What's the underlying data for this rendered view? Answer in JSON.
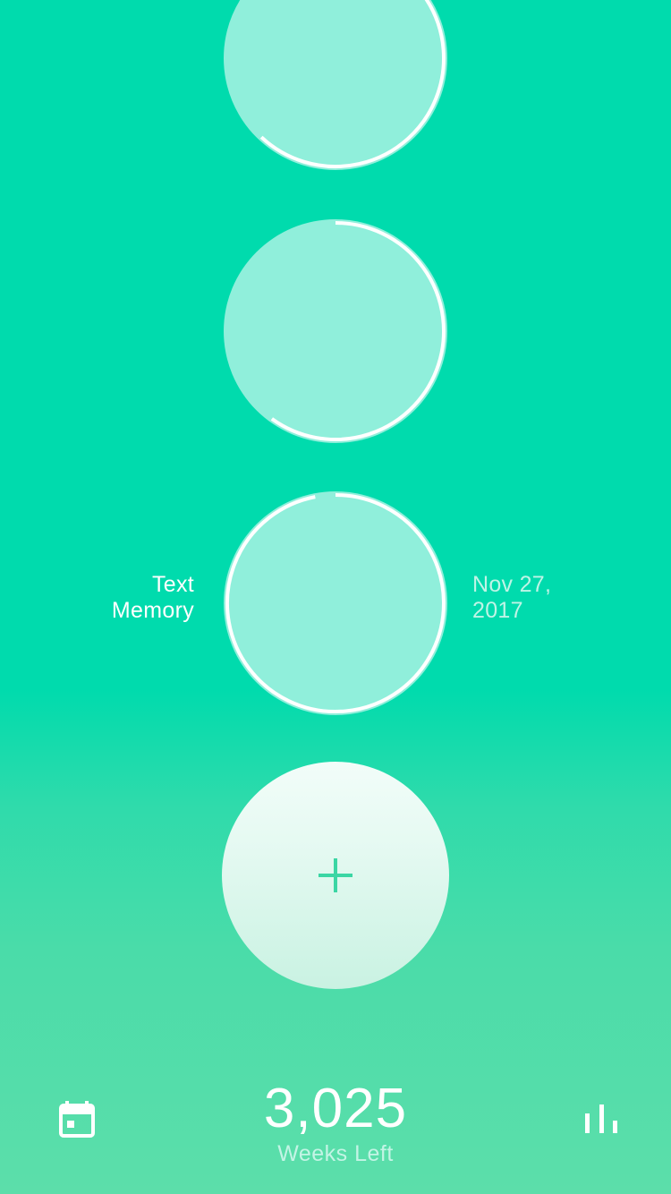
{
  "memories": [
    {
      "progress": 0.62
    },
    {
      "progress": 0.6
    },
    {
      "title_line1": "Text",
      "title_line2": "Memory",
      "date_line1": "Nov 27,",
      "date_line2": "2017",
      "progress": 0.97
    }
  ],
  "add_button": {
    "icon": "plus-icon"
  },
  "footer": {
    "calendar_icon": "calendar-icon",
    "weeks_left_value": "3,025",
    "weeks_left_label": "Weeks Left",
    "stats_icon": "bar-chart-icon"
  },
  "colors": {
    "background_top": "#00dbad",
    "background_bottom": "#5cdeaa",
    "circle_fill": "#90efdb",
    "progress_ring": "#ffffff",
    "accent": "#3bd6a4"
  }
}
